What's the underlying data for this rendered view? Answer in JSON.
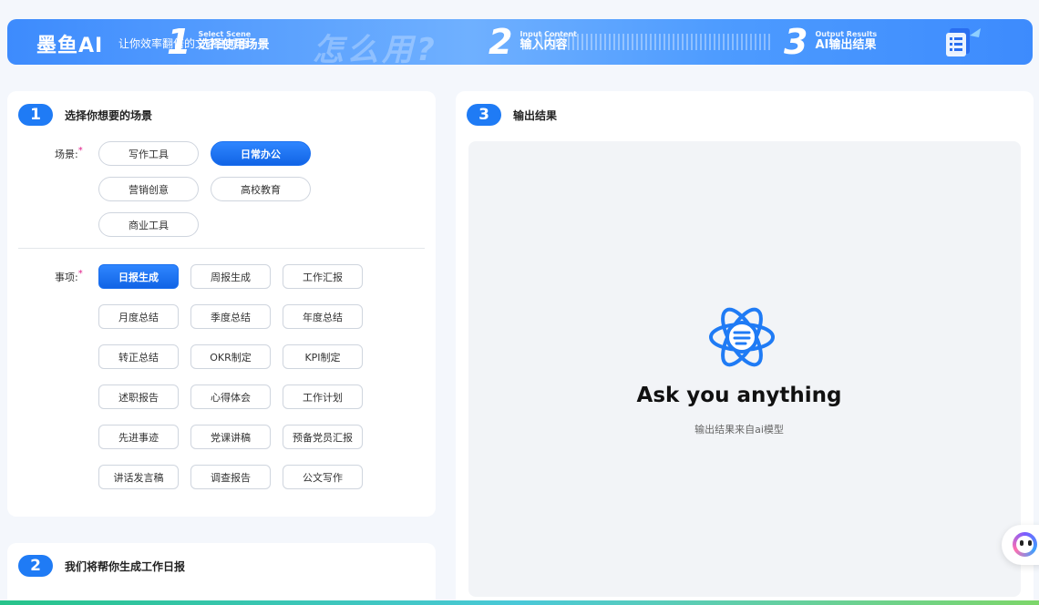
{
  "banner": {
    "brand": "墨鱼AI",
    "slogan": "让你效率翻倍的文字生成器",
    "ghost_text": "怎么用?",
    "steps": [
      {
        "num": "1",
        "en": "Select Scene",
        "cn": "选择使用场景"
      },
      {
        "num": "2",
        "en": "Input Content",
        "cn": "输入内容"
      },
      {
        "num": "3",
        "en": "Output Results",
        "cn": "AI输出结果"
      }
    ]
  },
  "section1": {
    "num": "1",
    "title": "选择你想要的场景",
    "scene_label": "场景:",
    "scenes": [
      "写作工具",
      "日常办公",
      "营销创意",
      "高校教育",
      "商业工具"
    ],
    "selected_scene": "日常办公",
    "item_label": "事项:",
    "items": [
      "日报生成",
      "周报生成",
      "工作汇报",
      "月度总结",
      "季度总结",
      "年度总结",
      "转正总结",
      "OKR制定",
      "KPI制定",
      "述职报告",
      "心得体会",
      "工作计划",
      "先进事迹",
      "党课讲稿",
      "预备党员汇报",
      "讲话发言稿",
      "调查报告",
      "公文写作"
    ],
    "selected_item": "日报生成"
  },
  "section2": {
    "num": "2",
    "title": "我们将帮你生成工作日报"
  },
  "section3": {
    "num": "3",
    "title": "输出结果",
    "empty_title": "Ask you anything",
    "empty_subtitle": "输出结果来自ai模型"
  },
  "colors": {
    "accent": "#1f7bf5",
    "required_mark": "#e0208a"
  },
  "icons": [
    "atom-chat-icon",
    "robot-assistant-icon",
    "document-deco-icon"
  ]
}
